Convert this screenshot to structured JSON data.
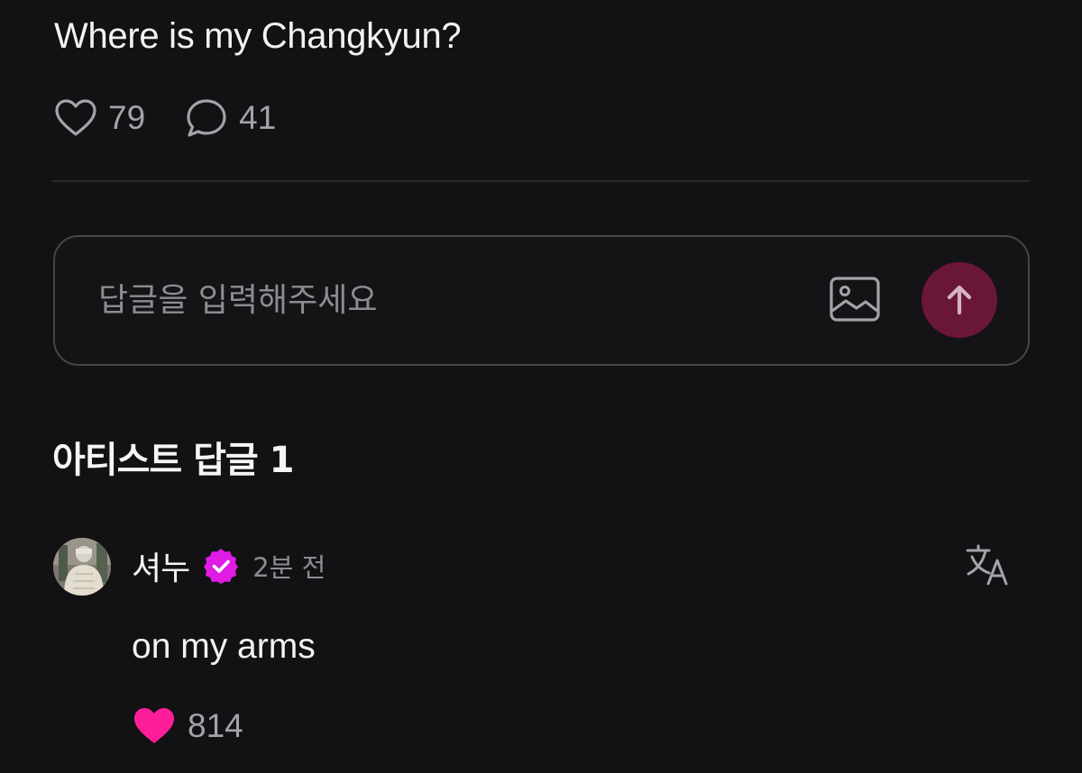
{
  "post": {
    "text": "Where is my Changkyun?",
    "like_count": "79",
    "comment_count": "41"
  },
  "reply_box": {
    "placeholder": "답글을 입력해주세요",
    "image_icon": "image-icon",
    "send_icon": "arrow-up-icon",
    "send_color": "#6a1638"
  },
  "artist_section": {
    "title": "아티스트 답글 1"
  },
  "comment": {
    "author": "셔누",
    "badge_icon": "verified-badge-icon",
    "badge_color": "#e11be6",
    "time": "2분 전",
    "translate_icon": "translate-icon",
    "text": "on my arms",
    "like_count": "814",
    "like_color": "#ff1e9a"
  }
}
